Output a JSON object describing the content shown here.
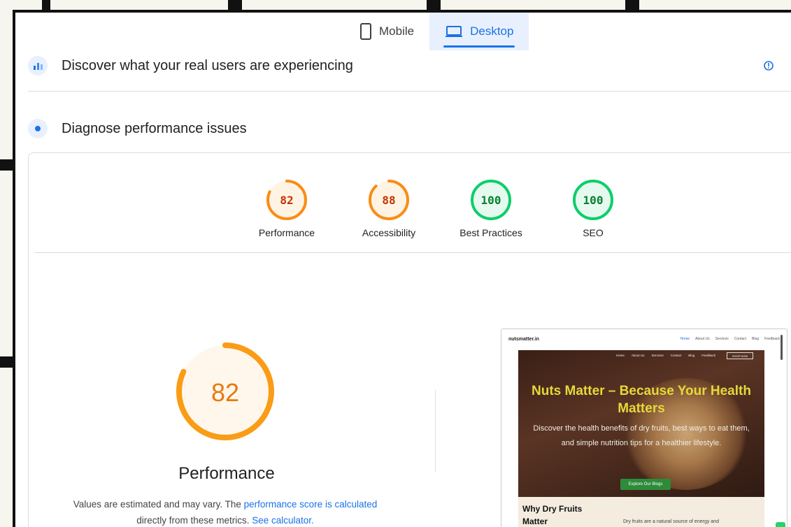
{
  "tabs": [
    {
      "label": "Mobile",
      "icon": "phone-icon",
      "active": false
    },
    {
      "label": "Desktop",
      "icon": "laptop-icon",
      "active": true
    }
  ],
  "sections": {
    "real_users": {
      "title": "Discover what your real users are experiencing",
      "icon": "users-chart-icon",
      "info_icon": "info-icon"
    },
    "diagnose": {
      "title": "Diagnose performance issues",
      "icon": "lighthouse-icon"
    }
  },
  "scores": [
    {
      "label": "Performance",
      "value": "82",
      "score": 0.82,
      "color": "#fa8c16",
      "fill": "#fff3e3"
    },
    {
      "label": "Accessibility",
      "value": "88",
      "score": 0.88,
      "color": "#fa8c16",
      "fill": "#fff3e3"
    },
    {
      "label": "Best Practices",
      "value": "100",
      "score": 1.0,
      "color": "#0cce6b",
      "fill": "#e6f9ee"
    },
    {
      "label": "SEO",
      "value": "100",
      "score": 1.0,
      "color": "#0cce6b",
      "fill": "#e6f9ee"
    }
  ],
  "main_score": {
    "value": "82",
    "score": 0.82,
    "label": "Performance",
    "color": "#fa9c16"
  },
  "description": {
    "text1": "Values are estimated and may vary. The ",
    "link1": "performance score is calculated",
    "text2": "directly from these metrics. ",
    "link2": "See calculator."
  },
  "screenshot": {
    "site": "nutsmatter.in",
    "nav_links": [
      "Home",
      "About Us",
      "Services",
      "Contact",
      "Blog",
      "Feedback"
    ],
    "shop_button": "SHOP NOW",
    "hero_title": "Nuts Matter – Because Your Health Matters",
    "hero_sub": "Discover the health benefits of dry fruits, best ways to eat them, and simple nutrition tips for a healthier lifestyle.",
    "cta": "Explore Our Blogs",
    "section_heading": "Why Dry Fruits Matter",
    "section_text": "Dry fruits are a natural source of energy and"
  }
}
